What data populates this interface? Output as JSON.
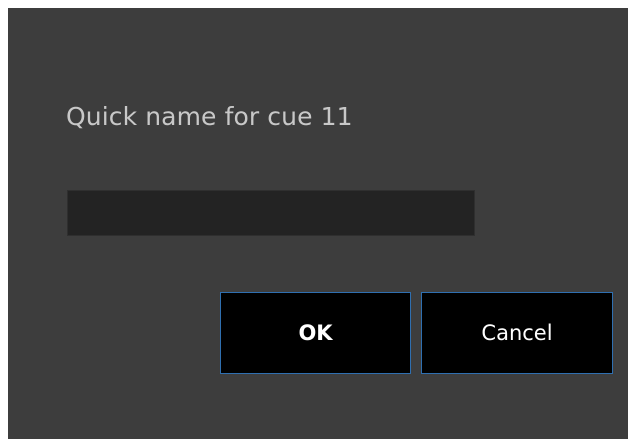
{
  "dialog": {
    "prompt": "Quick name for cue 11",
    "input_value": "",
    "input_placeholder": "",
    "ok_label": "OK",
    "cancel_label": "Cancel"
  },
  "colors": {
    "background": "#3d3d3d",
    "input_background": "#232323",
    "button_background": "#000000",
    "button_border": "#2f6fb0",
    "prompt_text": "#c8c8c8"
  }
}
